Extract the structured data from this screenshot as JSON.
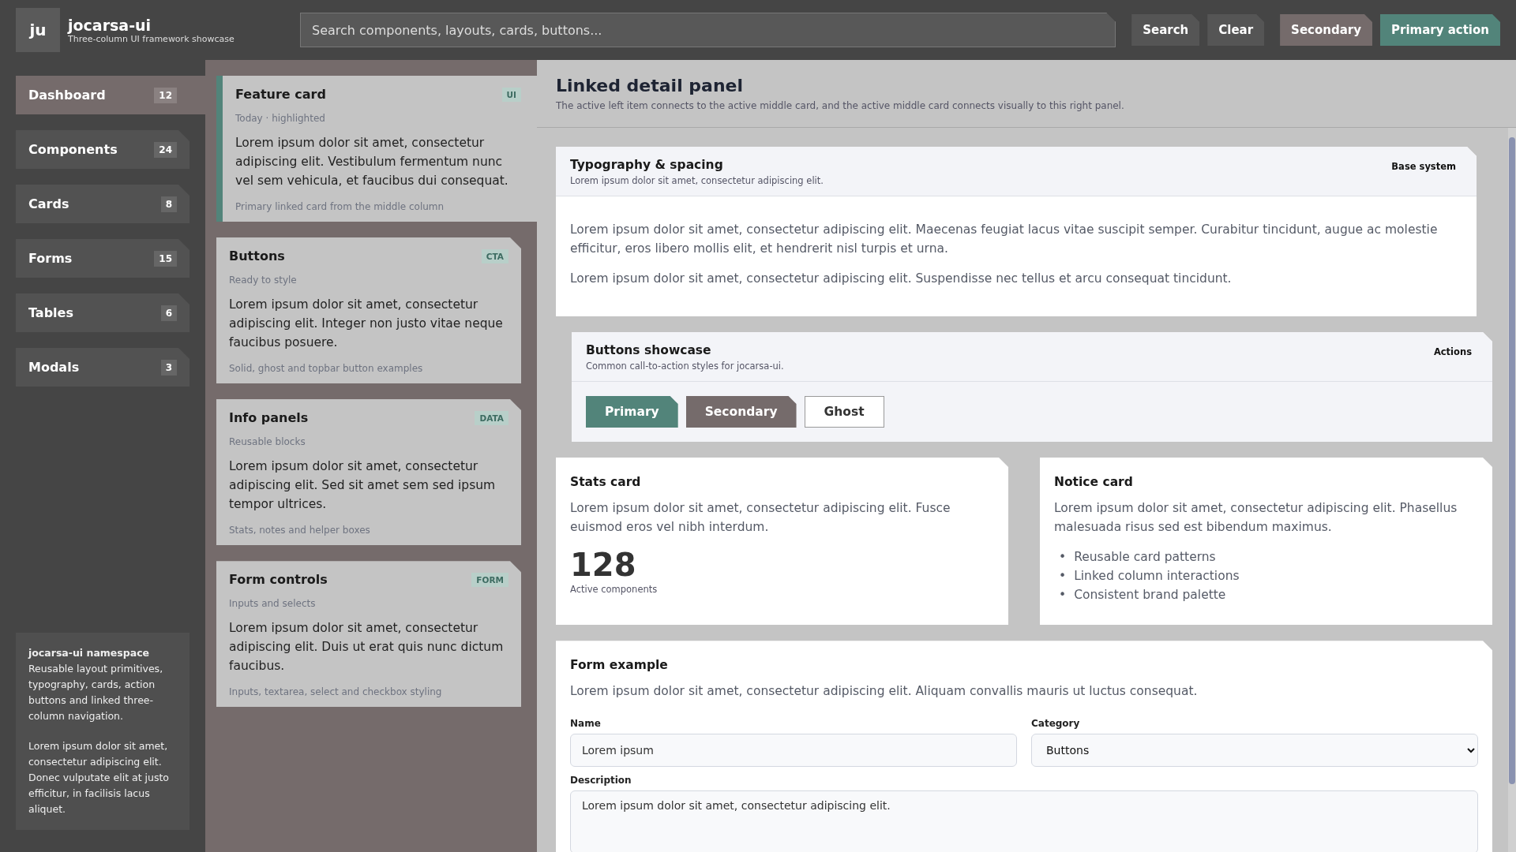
{
  "brand": {
    "logo": "ju",
    "name": "jocarsa-ui",
    "tagline": "Three-column UI framework showcase"
  },
  "search": {
    "placeholder": "Search components, layouts, cards, buttons..."
  },
  "topbar_buttons": [
    {
      "label": "Search",
      "kind": "plain"
    },
    {
      "label": "Clear",
      "kind": "plain"
    },
    {
      "label": "Secondary",
      "kind": "secondary"
    },
    {
      "label": "Primary action",
      "kind": "primary"
    }
  ],
  "sidebar": {
    "items": [
      {
        "label": "Dashboard",
        "count": "12",
        "selected": true
      },
      {
        "label": "Components",
        "count": "24",
        "selected": false
      },
      {
        "label": "Cards",
        "count": "8",
        "selected": false
      },
      {
        "label": "Forms",
        "count": "15",
        "selected": false
      },
      {
        "label": "Tables",
        "count": "6",
        "selected": false
      },
      {
        "label": "Modals",
        "count": "3",
        "selected": false
      }
    ],
    "note": {
      "title": "jocarsa-ui namespace",
      "text": "Reusable layout primitives, typography, cards, action buttons and linked three-column navigation.",
      "text_2": "Lorem ipsum dolor sit amet, consectetur adipiscing elit. Donec vulputate elit at justo efficitur, in facilisis lacus aliquet."
    }
  },
  "cards": [
    {
      "title": "Feature card",
      "tag": "UI",
      "meta": "Today · highlighted",
      "body": "Lorem ipsum dolor sit amet, consectetur adipiscing elit. Vestibulum fermentum nunc vel sem vehicula, et faucibus dui consequat.",
      "footer": "Primary linked card from the middle column",
      "selected": true
    },
    {
      "title": "Buttons",
      "tag": "CTA",
      "meta": "Ready to style",
      "body": "Lorem ipsum dolor sit amet, consectetur adipiscing elit. Integer non justo vitae neque faucibus posuere.",
      "footer": "Solid, ghost and topbar button examples",
      "selected": false
    },
    {
      "title": "Info panels",
      "tag": "DATA",
      "meta": "Reusable blocks",
      "body": "Lorem ipsum dolor sit amet, consectetur adipiscing elit. Sed sit amet sem sed ipsum tempor ultrices.",
      "footer": "Stats, notes and helper boxes",
      "selected": false
    },
    {
      "title": "Form controls",
      "tag": "FORM",
      "meta": "Inputs and selects",
      "body": "Lorem ipsum dolor sit amet, consectetur adipiscing elit. Duis ut erat quis nunc dictum faucibus.",
      "footer": "Inputs, textarea, select and checkbox styling",
      "selected": false
    }
  ],
  "detail": {
    "title": "Linked detail panel",
    "subtitle": "The active left item connects to the active middle card, and the active middle card connects visually to this right panel.",
    "typography": {
      "title": "Typography & spacing",
      "subtitle": "Lorem ipsum dolor sit amet, consectetur adipiscing elit.",
      "label": "Base system",
      "paragraphs": [
        "Lorem ipsum dolor sit amet, consectetur adipiscing elit. Maecenas feugiat lacus vitae suscipit semper. Curabitur tincidunt, augue ac molestie efficitur, eros libero mollis elit, et hendrerit nisl turpis et urna.",
        "Lorem ipsum dolor sit amet, consectetur adipiscing elit. Suspendisse nec tellus et arcu consequat tincidunt."
      ]
    },
    "showcase": {
      "title": "Buttons showcase",
      "subtitle": "Common call-to-action styles for jocarsa-ui.",
      "label": "Actions",
      "buttons": [
        {
          "label": "Primary",
          "kind": "primary"
        },
        {
          "label": "Secondary",
          "kind": "secondary"
        },
        {
          "label": "Ghost",
          "kind": "ghost"
        }
      ]
    },
    "stats": {
      "title": "Stats card",
      "text": "Lorem ipsum dolor sit amet, consectetur adipiscing elit. Fusce euismod eros vel nibh interdum.",
      "value": "128",
      "caption": "Active components"
    },
    "notice": {
      "title": "Notice card",
      "text": "Lorem ipsum dolor sit amet, consectetur adipiscing elit. Phasellus malesuada risus sed est bibendum maximus.",
      "items": [
        {
          "marker": "•",
          "text": "Reusable card patterns"
        },
        {
          "marker": "•",
          "text": "Linked column interactions"
        },
        {
          "marker": "•",
          "text": "Consistent brand palette"
        }
      ]
    },
    "form": {
      "title": "Form example",
      "text": "Lorem ipsum dolor sit amet, consectetur adipiscing elit. Aliquam convallis mauris ut luctus consequat.",
      "name_label": "Name",
      "name_value": "Lorem ipsum",
      "category_label": "Category",
      "category_value": "Buttons",
      "description_label": "Description",
      "description_value": "Lorem ipsum dolor sit amet, consectetur adipiscing elit."
    }
  }
}
